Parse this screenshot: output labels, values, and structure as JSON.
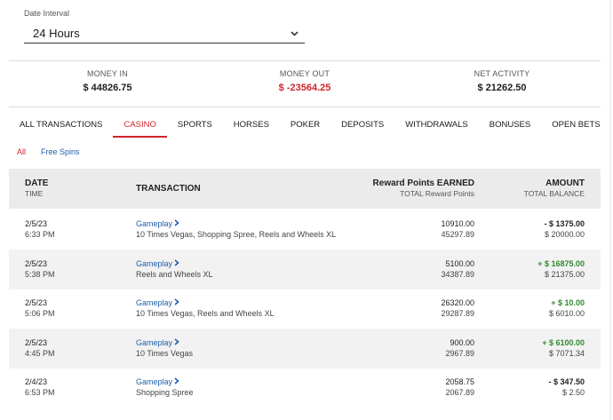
{
  "interval": {
    "label": "Date Interval",
    "value": "24 Hours"
  },
  "summary": [
    {
      "label": "MONEY IN",
      "value": "$ 44826.75",
      "color": "#1f1f1f"
    },
    {
      "label": "MONEY OUT",
      "value": "$ -23564.25",
      "color": "#d0242a"
    },
    {
      "label": "NET ACTIVITY",
      "value": "$ 21262.50",
      "color": "#1f1f1f"
    }
  ],
  "tabs": [
    "ALL TRANSACTIONS",
    "CASINO",
    "SPORTS",
    "HORSES",
    "POKER",
    "DEPOSITS",
    "WITHDRAWALS",
    "BONUSES",
    "OPEN BETS"
  ],
  "active_tab": "CASINO",
  "subfilters": [
    "All",
    "Free Spins"
  ],
  "table": {
    "headers": {
      "date": "DATE",
      "time": "TIME",
      "transaction": "TRANSACTION",
      "points": "Reward Points EARNED",
      "points_total": "TOTAL Reward Points",
      "amount": "AMOUNT",
      "balance": "TOTAL BALANCE"
    },
    "rows": [
      {
        "date": "2/5/23",
        "time": "6:33 PM",
        "type": "Gameplay",
        "games": "10 Times Vegas, Shopping Spree, Reels and Wheels XL",
        "points": "10910.00",
        "points_total": "45297.89",
        "amount": "- $ 1375.00",
        "balance": "$ 20000.00",
        "direction": "out"
      },
      {
        "date": "2/5/23",
        "time": "5:38 PM",
        "type": "Gameplay",
        "games": "Reels and Wheels XL",
        "points": "5100.00",
        "points_total": "34387.89",
        "amount": "+ $ 16875.00",
        "balance": "$ 21375.00",
        "direction": "in"
      },
      {
        "date": "2/5/23",
        "time": "5:06 PM",
        "type": "Gameplay",
        "games": "10 Times Vegas, Reels and Wheels XL",
        "points": "26320.00",
        "points_total": "29287.89",
        "amount": "+ $ 10.00",
        "balance": "$ 6010.00",
        "direction": "in"
      },
      {
        "date": "2/5/23",
        "time": "4:45 PM",
        "type": "Gameplay",
        "games": "10 Times Vegas",
        "points": "900.00",
        "points_total": "2967.89",
        "amount": "+ $ 6100.00",
        "balance": "$ 7071.34",
        "direction": "in"
      },
      {
        "date": "2/4/23",
        "time": "6:53 PM",
        "type": "Gameplay",
        "games": "Shopping Spree",
        "points": "2058.75",
        "points_total": "2067.89",
        "amount": "- $ 347.50",
        "balance": "$ 2.50",
        "direction": "out"
      }
    ]
  }
}
